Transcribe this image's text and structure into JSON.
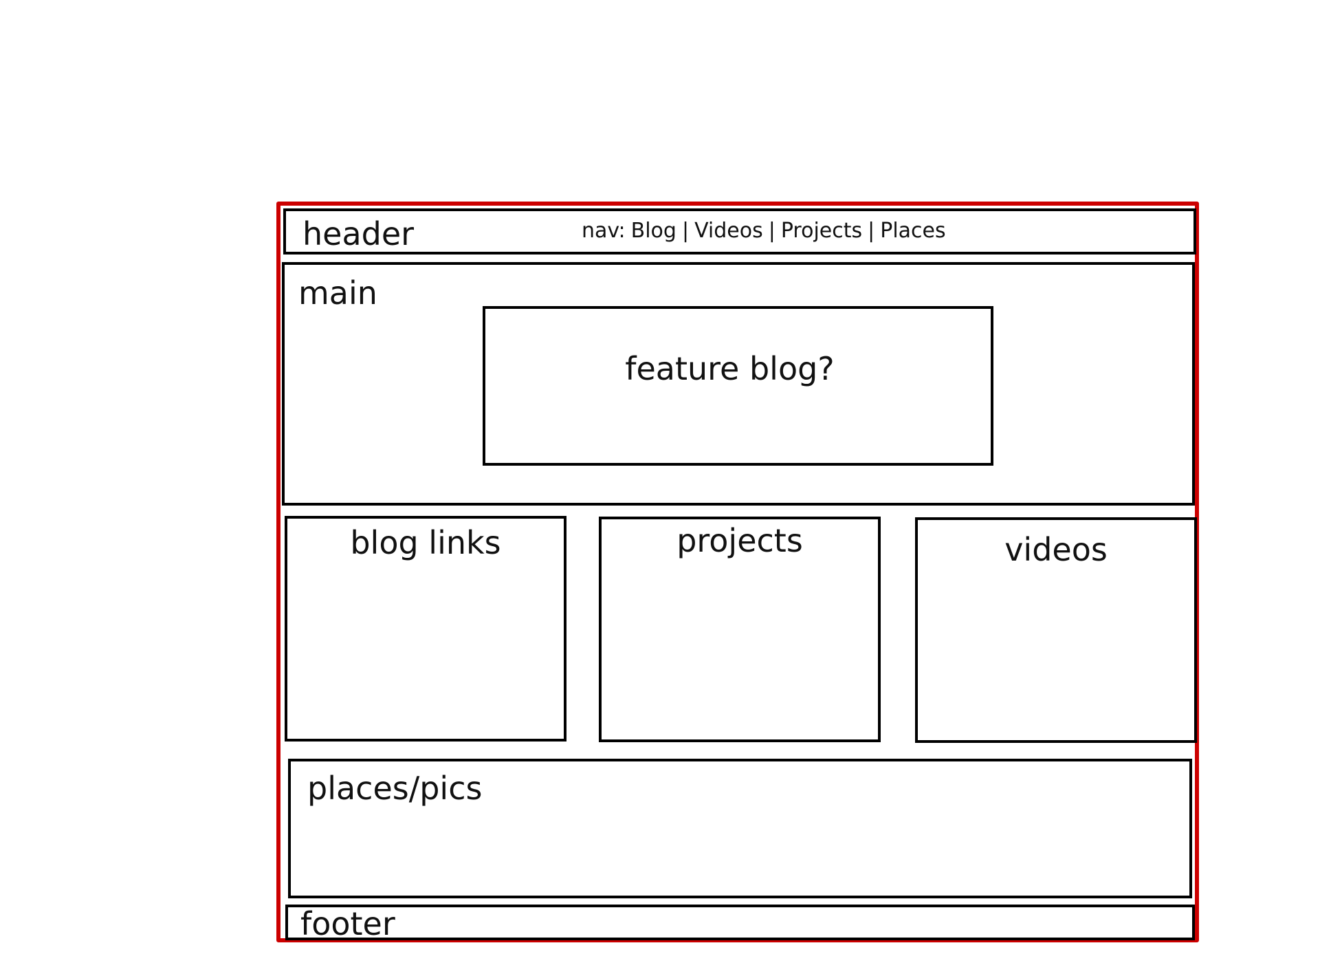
{
  "header": {
    "label": "header",
    "nav_prefix": "nav:",
    "nav_items": [
      "Blog",
      "Videos",
      "Projects",
      "Places"
    ],
    "nav_separator": "|"
  },
  "main": {
    "label": "main",
    "feature_label": "feature blog?"
  },
  "sections": {
    "blog_links": "blog links",
    "projects": "projects",
    "videos": "videos"
  },
  "places": {
    "label": "places/pics"
  },
  "footer": {
    "label": "footer"
  },
  "colors": {
    "outer_frame": "#cc0000",
    "box_border": "#000000",
    "text": "#111111",
    "background": "#ffffff"
  }
}
